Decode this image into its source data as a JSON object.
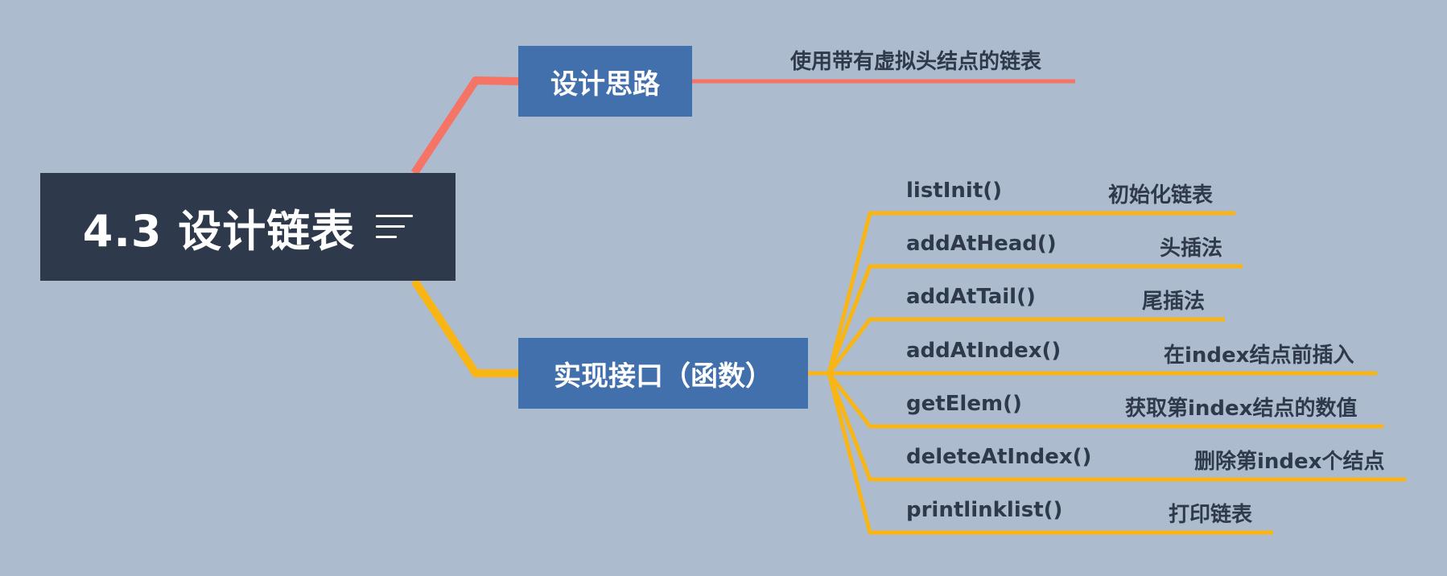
{
  "root": {
    "title": "4.3 设计链表",
    "icon": "menu-lines-icon"
  },
  "branches": {
    "design": {
      "label": "设计思路",
      "color": "#f57465",
      "note": "使用带有虚拟头结点的链表"
    },
    "interface": {
      "label": "实现接口（函数）",
      "color": "#f8b514",
      "items": [
        {
          "func": "listInit()",
          "desc": "初始化链表"
        },
        {
          "func": "addAtHead()",
          "desc": "头插法"
        },
        {
          "func": "addAtTail()",
          "desc": "尾插法"
        },
        {
          "func": "addAtIndex()",
          "desc": "在index结点前插入"
        },
        {
          "func": "getElem()",
          "desc": "获取第index结点的数值"
        },
        {
          "func": "deleteAtIndex()",
          "desc": "删除第index个结点"
        },
        {
          "func": "printlinklist()",
          "desc": "打印链表"
        }
      ]
    }
  },
  "colors": {
    "background": "#adbbcf",
    "root_fill": "#2e3a4b",
    "branch_fill": "#4270ad",
    "text": "#2e3a4b"
  }
}
